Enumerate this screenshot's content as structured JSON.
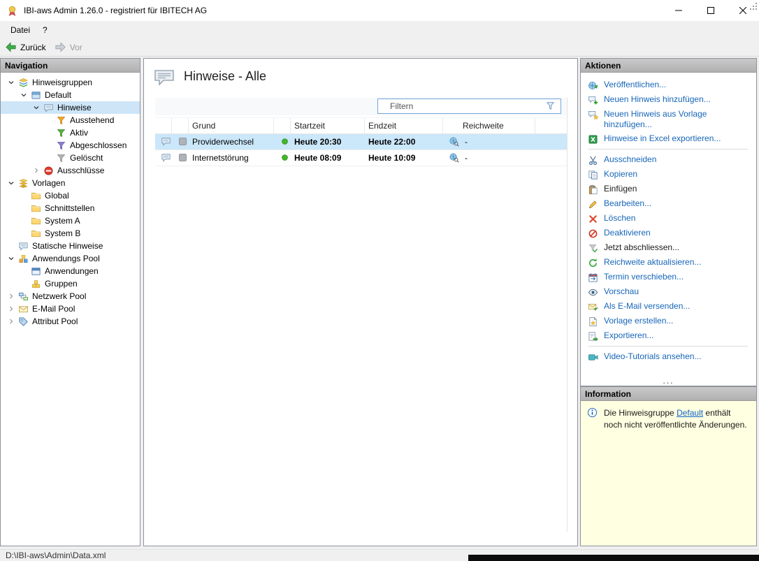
{
  "window": {
    "title": "IBI-aws Admin 1.26.0 - registriert für IBITECH AG"
  },
  "menubar": {
    "items": [
      {
        "label": "Datei"
      },
      {
        "label": "?"
      }
    ]
  },
  "toolbar": {
    "back_label": "Zurück",
    "forward_label": "Vor"
  },
  "navigation": {
    "header": "Navigation",
    "items": [
      {
        "label": "Hinweisgruppen",
        "depth": 0,
        "expand": "open",
        "icon": "group-stack",
        "selected": false
      },
      {
        "label": "Default",
        "depth": 1,
        "expand": "open",
        "icon": "hint-group",
        "selected": false
      },
      {
        "label": "Hinweise",
        "depth": 2,
        "expand": "open",
        "icon": "bubble",
        "selected": true
      },
      {
        "label": "Ausstehend",
        "depth": 3,
        "expand": "none",
        "icon": "funnel-orange",
        "selected": false
      },
      {
        "label": "Aktiv",
        "depth": 3,
        "expand": "none",
        "icon": "funnel-green",
        "selected": false
      },
      {
        "label": "Abgeschlossen",
        "depth": 3,
        "expand": "none",
        "icon": "funnel-violet",
        "selected": false
      },
      {
        "label": "Gelöscht",
        "depth": 3,
        "expand": "none",
        "icon": "funnel-gray",
        "selected": false
      },
      {
        "label": "Ausschlüsse",
        "depth": 2,
        "expand": "closed",
        "icon": "no-entry",
        "selected": false
      },
      {
        "label": "Vorlagen",
        "depth": 0,
        "expand": "open",
        "icon": "templates",
        "selected": false
      },
      {
        "label": "Global",
        "depth": 1,
        "expand": "none",
        "icon": "folder",
        "selected": false
      },
      {
        "label": "Schnittstellen",
        "depth": 1,
        "expand": "none",
        "icon": "folder",
        "selected": false
      },
      {
        "label": "System A",
        "depth": 1,
        "expand": "none",
        "icon": "folder",
        "selected": false
      },
      {
        "label": "System B",
        "depth": 1,
        "expand": "none",
        "icon": "folder",
        "selected": false
      },
      {
        "label": "Statische Hinweise",
        "depth": 0,
        "expand": "none",
        "icon": "bubble",
        "selected": false
      },
      {
        "label": "Anwendungs Pool",
        "depth": 0,
        "expand": "open",
        "icon": "cubes",
        "selected": false
      },
      {
        "label": "Anwendungen",
        "depth": 1,
        "expand": "none",
        "icon": "app-window",
        "selected": false
      },
      {
        "label": "Gruppen",
        "depth": 1,
        "expand": "none",
        "icon": "cubes-yellow",
        "selected": false
      },
      {
        "label": "Netzwerk Pool",
        "depth": 0,
        "expand": "closed",
        "icon": "network",
        "selected": false
      },
      {
        "label": "E-Mail Pool",
        "depth": 0,
        "expand": "closed",
        "icon": "mail",
        "selected": false
      },
      {
        "label": "Attribut Pool",
        "depth": 0,
        "expand": "closed",
        "icon": "attribute",
        "selected": false
      }
    ]
  },
  "main": {
    "title": "Hinweise - Alle",
    "filter": {
      "placeholder": "Filtern"
    },
    "table": {
      "columns": [
        "Grund",
        "Startzeit",
        "Endzeit",
        "Reichweite"
      ],
      "rows": [
        {
          "grund": "Providerwechsel",
          "start": "Heute 20:30",
          "end": "Heute 22:00",
          "reichweite": "-",
          "selected": true
        },
        {
          "grund": "Internetstörung",
          "start": "Heute 08:09",
          "end": "Heute 10:09",
          "reichweite": "-",
          "selected": false
        }
      ]
    }
  },
  "actions": {
    "header": "Aktionen",
    "overflow": "...",
    "items": [
      {
        "label": "Veröffentlichen...",
        "icon": "publish",
        "disabled": false,
        "separator_after": false
      },
      {
        "label": "Neuen Hinweis hinzufügen...",
        "icon": "bubble-add",
        "disabled": false,
        "separator_after": false
      },
      {
        "label": "Neuen Hinweis aus Vorlage hinzufügen...",
        "icon": "bubble-template",
        "disabled": false,
        "separator_after": false
      },
      {
        "label": "Hinweise in Excel exportieren...",
        "icon": "excel",
        "disabled": false,
        "separator_after": true
      },
      {
        "label": "Ausschneiden",
        "icon": "cut",
        "disabled": false,
        "separator_after": false
      },
      {
        "label": "Kopieren",
        "icon": "copy",
        "disabled": false,
        "separator_after": false
      },
      {
        "label": "Einfügen",
        "icon": "paste",
        "disabled": true,
        "separator_after": false
      },
      {
        "label": "Bearbeiten...",
        "icon": "edit",
        "disabled": false,
        "separator_after": false
      },
      {
        "label": "Löschen",
        "icon": "delete",
        "disabled": false,
        "separator_after": false
      },
      {
        "label": "Deaktivieren",
        "icon": "deactivate",
        "disabled": false,
        "separator_after": false
      },
      {
        "label": "Jetzt abschliessen...",
        "icon": "finish",
        "disabled": true,
        "separator_after": false
      },
      {
        "label": "Reichweite aktualisieren...",
        "icon": "refresh",
        "disabled": false,
        "separator_after": false
      },
      {
        "label": "Termin verschieben...",
        "icon": "reschedule",
        "disabled": false,
        "separator_after": false
      },
      {
        "label": "Vorschau",
        "icon": "preview",
        "disabled": false,
        "separator_after": false
      },
      {
        "label": "Als E-Mail versenden...",
        "icon": "send-mail",
        "disabled": false,
        "separator_after": false
      },
      {
        "label": "Vorlage erstellen...",
        "icon": "create-template",
        "disabled": false,
        "separator_after": false
      },
      {
        "label": "Exportieren...",
        "icon": "export",
        "disabled": false,
        "separator_after": true
      },
      {
        "label": "Video-Tutorials ansehen...",
        "icon": "video",
        "disabled": false,
        "separator_after": false
      }
    ]
  },
  "information": {
    "header": "Information",
    "text_before": "Die Hinweisgruppe ",
    "link": "Default",
    "text_after": " enthält noch nicht veröffentlichte Änderungen."
  },
  "statusbar": {
    "path": "D:\\IBI-aws\\Admin\\Data.xml"
  },
  "colors": {
    "action_link_blue": "#1766b8",
    "hyperlink_blue": "#0f64c8",
    "row_selection_blue": "#cbe7fa",
    "tree_selection_blue": "#cde5f7",
    "info_background_yellow": "#ffffe1",
    "status_dot_green": "#45b52d",
    "panel_header_gray": "#bcbcbc"
  }
}
